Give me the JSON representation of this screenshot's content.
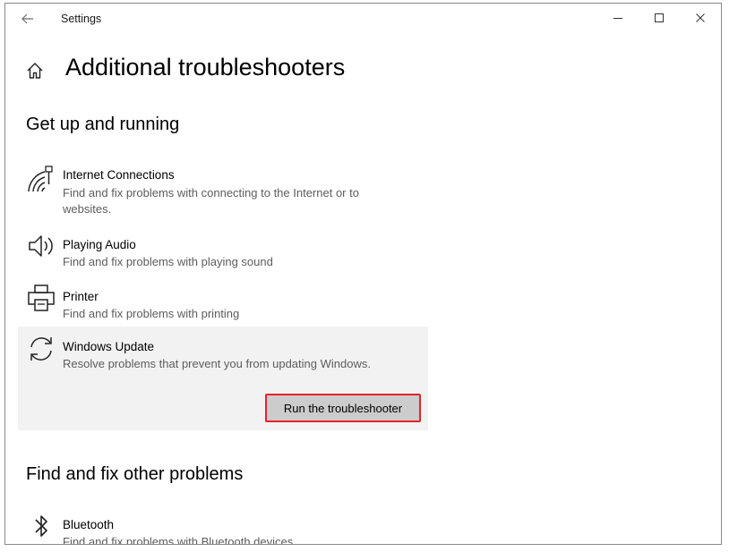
{
  "window": {
    "title": "Settings",
    "border_color": "#8a8a8a"
  },
  "page": {
    "title": "Additional troubleshooters"
  },
  "sections": [
    {
      "heading": "Get up and running",
      "items": [
        {
          "icon": "wifi-wrench-icon",
          "name": "Internet Connections",
          "description": "Find and fix problems with connecting to the Internet or to websites."
        },
        {
          "icon": "speaker-icon",
          "name": "Playing Audio",
          "description": "Find and fix problems with playing sound"
        },
        {
          "icon": "printer-icon",
          "name": "Printer",
          "description": "Find and fix problems with printing"
        },
        {
          "icon": "sync-icon",
          "name": "Windows Update",
          "description": "Resolve problems that prevent you from updating Windows.",
          "selected": true,
          "button_label": "Run the troubleshooter"
        }
      ]
    },
    {
      "heading": "Find and fix other problems",
      "items": [
        {
          "icon": "bluetooth-icon",
          "name": "Bluetooth",
          "description": "Find and fix problems with Bluetooth devices"
        }
      ]
    }
  ],
  "colors": {
    "selected_bg": "#f2f2f2",
    "button_bg": "#cccccc",
    "highlight_border": "#e5232b",
    "description_text": "#5d5d5d"
  }
}
